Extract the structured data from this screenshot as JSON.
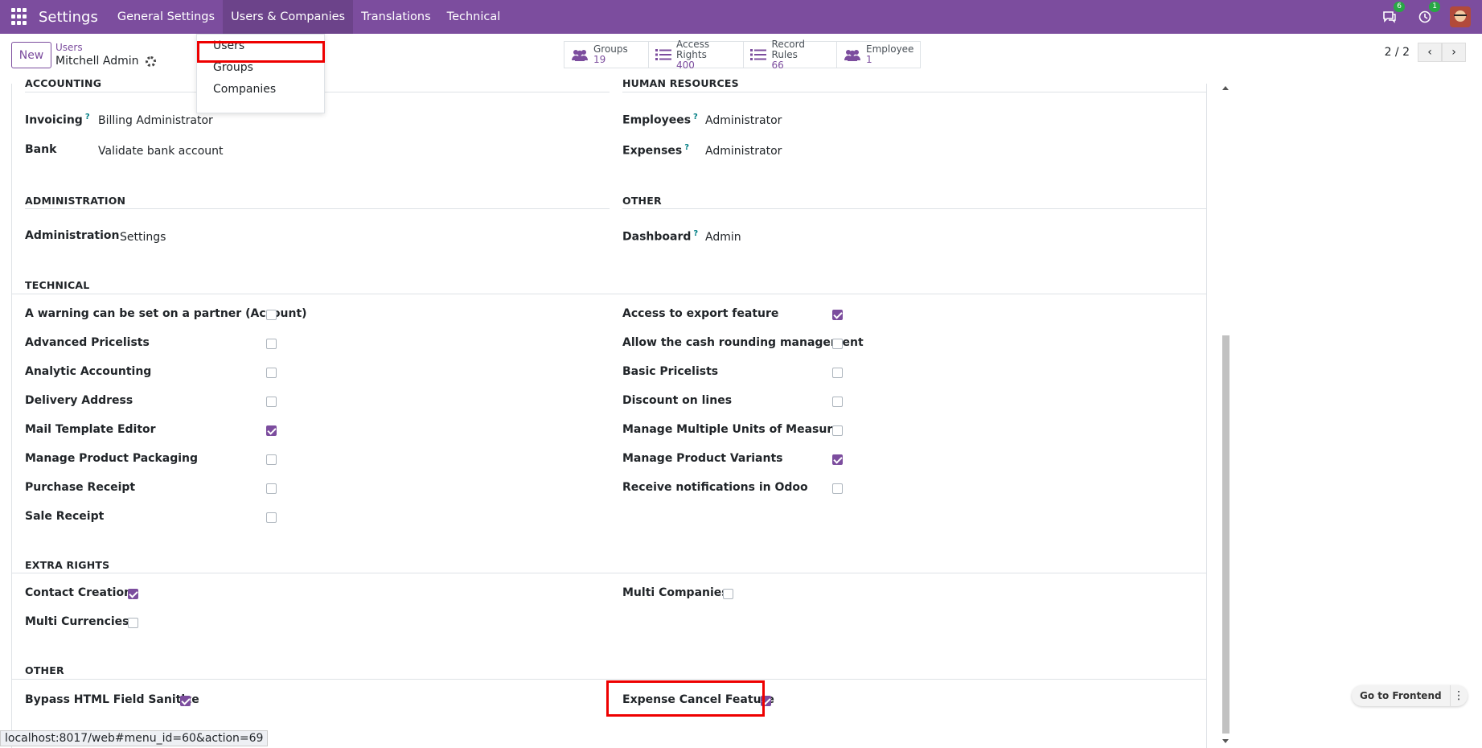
{
  "topbar": {
    "brand": "Settings",
    "menu": [
      "General Settings",
      "Users & Companies",
      "Translations",
      "Technical"
    ],
    "chat_badge": "6",
    "activity_badge": "1"
  },
  "dropdown": {
    "items": [
      "Users",
      "Groups",
      "Companies"
    ]
  },
  "control_panel": {
    "new_label": "New",
    "breadcrumb": "Users",
    "record_name": "Mitchell Admin",
    "smart_buttons": [
      {
        "label": "Groups",
        "value": "19"
      },
      {
        "label": "Access Rights",
        "value": "400"
      },
      {
        "label": "Record Rules",
        "value": "66"
      },
      {
        "label": "Employee",
        "value": "1"
      }
    ],
    "pager": "2 / 2"
  },
  "sections": {
    "accounting": {
      "title": "ACCOUNTING",
      "rows": [
        {
          "label": "Invoicing",
          "help": "?",
          "value": "Billing Administrator"
        },
        {
          "label": "Bank",
          "value": "Validate bank account"
        }
      ]
    },
    "human_resources": {
      "title": "HUMAN RESOURCES",
      "rows": [
        {
          "label": "Employees",
          "help": "?",
          "value": "Administrator"
        },
        {
          "label": "Expenses",
          "help": "?",
          "value": "Administrator"
        }
      ]
    },
    "administration": {
      "title": "ADMINISTRATION",
      "rows": [
        {
          "label": "Administration",
          "value": "Settings"
        }
      ]
    },
    "other_top": {
      "title": "OTHER",
      "rows": [
        {
          "label": "Dashboard",
          "help": "?",
          "value": "Admin"
        }
      ]
    },
    "technical": {
      "title": "TECHNICAL",
      "left": [
        {
          "label": "A warning can be set on a partner (Account)",
          "checked": false
        },
        {
          "label": "Advanced Pricelists",
          "checked": false
        },
        {
          "label": "Analytic Accounting",
          "checked": false
        },
        {
          "label": "Delivery Address",
          "checked": false
        },
        {
          "label": "Mail Template Editor",
          "checked": true
        },
        {
          "label": "Manage Product Packaging",
          "checked": false
        },
        {
          "label": "Purchase Receipt",
          "checked": false
        },
        {
          "label": "Sale Receipt",
          "checked": false
        }
      ],
      "right": [
        {
          "label": "Access to export feature",
          "checked": true
        },
        {
          "label": "Allow the cash rounding management",
          "checked": false
        },
        {
          "label": "Basic Pricelists",
          "checked": false
        },
        {
          "label": "Discount on lines",
          "checked": false
        },
        {
          "label": "Manage Multiple Units of Measure",
          "checked": false
        },
        {
          "label": "Manage Product Variants",
          "checked": true
        },
        {
          "label": "Receive notifications in Odoo",
          "checked": false
        }
      ]
    },
    "extra_rights": {
      "title": "EXTRA RIGHTS",
      "left": [
        {
          "label": "Contact Creation",
          "checked": true
        },
        {
          "label": "Multi Currencies",
          "checked": false
        }
      ],
      "right": [
        {
          "label": "Multi Companies",
          "checked": false
        }
      ]
    },
    "other": {
      "title": "OTHER",
      "left": [
        {
          "label": "Bypass HTML Field Sanitize",
          "checked": true
        }
      ],
      "right": [
        {
          "label": "Expense Cancel Feature",
          "checked": true
        }
      ]
    }
  },
  "status_url": "localhost:8017/web#menu_id=60&action=69",
  "frontend_button": "Go to Frontend",
  "colors": {
    "brand": "#7c4d9e",
    "highlight": "#e00000"
  }
}
